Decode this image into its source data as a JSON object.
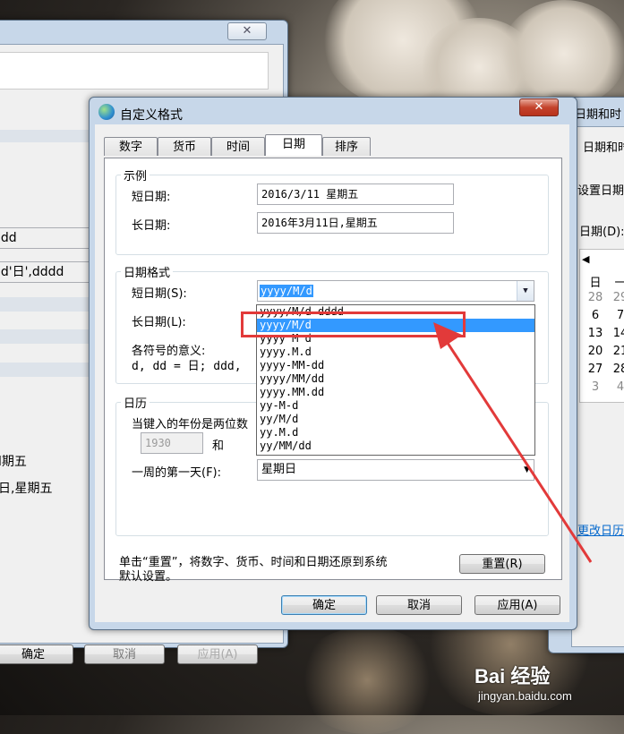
{
  "dialog": {
    "title": "自定义格式",
    "tabs": [
      "数字",
      "货币",
      "时间",
      "日期",
      "排序"
    ],
    "active_tab": "日期",
    "example": {
      "group_title": "示例",
      "short_label": "短日期:",
      "short_value": "2016/3/11 星期五",
      "long_label": "长日期:",
      "long_value": "2016年3月11日,星期五"
    },
    "format": {
      "group_title": "日期格式",
      "short_label": "短日期(S):",
      "short_value": "yyyy/M/d",
      "long_label": "长日期(L):",
      "symbols_label": "各符号的意义:",
      "symbols_text": "d, dd = 日;  ddd,",
      "dropdown_options": [
        "yyyy/M/d dddd",
        "yyyy/M/d",
        "yyyy M d",
        "yyyy.M.d",
        "yyyy-MM-dd",
        "yyyy/MM/dd",
        "yyyy.MM.dd",
        "yy-M-d",
        "yy/M/d",
        "yy.M.d",
        "yy/MM/dd"
      ],
      "selected_option": "yyyy/M/d"
    },
    "calendar": {
      "group_title": "日历",
      "two_digit_label": "当键入的年份是两位数",
      "year_value": "1930",
      "and_label": "和",
      "first_day_label": "一周的第一天(F):",
      "first_day_value": "星期日"
    },
    "reset_note_line1": "单击“重置”，将数字、货币、时间和日期还原到系统",
    "reset_note_line2": "默认设置。",
    "reset_button": "重置(R)",
    "ok_button": "确定",
    "cancel_button": "取消",
    "apply_button": "应用(A)"
  },
  "background_left_window": {
    "close_glyph": "✕",
    "field1": "ldd",
    "field2": "'d'日',dddd",
    "text1": "l期五",
    "text2": "日,星期五",
    "ok_button": "确定",
    "cancel_button": "取消",
    "apply_button": "应用(A)"
  },
  "background_right_window": {
    "title": "日期和时",
    "tab_label": "日期和时",
    "text1": "设置日期",
    "text2": "日期(D):",
    "nav_arrow": "◀",
    "calendar_cells": [
      [
        "日",
        "一"
      ],
      [
        "28",
        "29"
      ],
      [
        "6",
        "7"
      ],
      [
        "13",
        "14"
      ],
      [
        "20",
        "21"
      ],
      [
        "27",
        "28"
      ],
      [
        "3",
        "4"
      ]
    ],
    "link": "更改日历"
  },
  "watermark": {
    "brand": "Bai 经验",
    "url": "jingyan.baidu.com"
  },
  "colors": {
    "highlight_box": "#e23a3a",
    "selection": "#3399ff"
  }
}
